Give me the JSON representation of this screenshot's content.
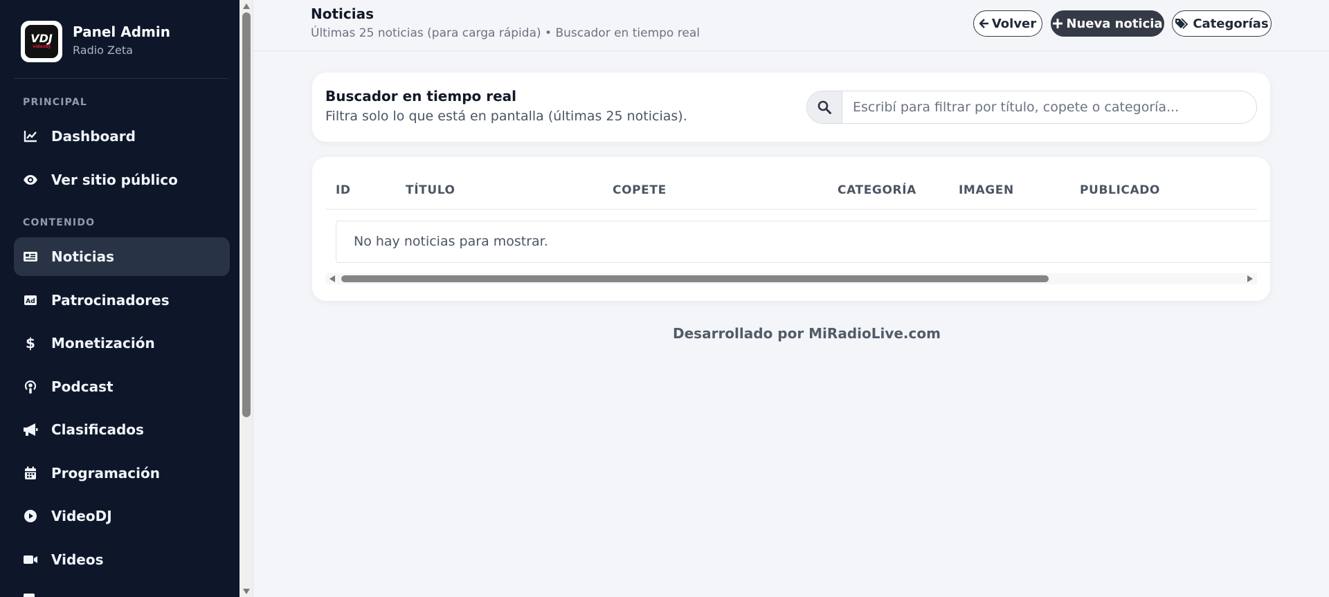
{
  "brand": {
    "name": "Panel Admin",
    "subtitle": "Radio Zeta",
    "logo_text": "VDJ",
    "logo_small": "videoDJ"
  },
  "sidebar": {
    "sections": [
      {
        "label": "PRINCIPAL"
      },
      {
        "label": "CONTENIDO"
      }
    ],
    "items": [
      {
        "label": "Dashboard",
        "icon": "chart-line-icon",
        "active": false
      },
      {
        "label": "Ver sitio público",
        "icon": "eye-icon",
        "active": false
      },
      {
        "label": "Noticias",
        "icon": "newspaper-icon",
        "active": true
      },
      {
        "label": "Patrocinadores",
        "icon": "ad-icon",
        "active": false
      },
      {
        "label": "Monetización",
        "icon": "dollar-icon",
        "active": false
      },
      {
        "label": "Podcast",
        "icon": "podcast-icon",
        "active": false
      },
      {
        "label": "Clasificados",
        "icon": "megaphone-icon",
        "active": false
      },
      {
        "label": "Programación",
        "icon": "calendar-icon",
        "active": false
      },
      {
        "label": "VideoDJ",
        "icon": "play-circle-icon",
        "active": false
      },
      {
        "label": "Videos",
        "icon": "video-camera-icon",
        "active": false
      }
    ]
  },
  "header": {
    "title": "Noticias",
    "subtitle": "Últimas 25 noticias (para carga rápida) • Buscador en tiempo real",
    "buttons": {
      "back": "Volver",
      "new": "Nueva noticia",
      "categories": "Categorías"
    }
  },
  "search": {
    "title": "Buscador en tiempo real",
    "description": "Filtra solo lo que está en pantalla (últimas 25 noticias).",
    "placeholder": "Escribí para filtrar por título, copete o categoría..."
  },
  "table": {
    "columns": [
      "ID",
      "TÍTULO",
      "COPETE",
      "CATEGORÍA",
      "IMAGEN",
      "PUBLICADO"
    ],
    "empty_message": "No hay noticias para mostrar."
  },
  "footer": {
    "text": "Desarrollado por MiRadioLive.com"
  },
  "colors": {
    "sidebar_bg": "#0e172a",
    "sidebar_active": "#283345",
    "page_bg": "#f3f5f9",
    "dark_button": "#353b46",
    "brand_red": "#e11d2e"
  }
}
